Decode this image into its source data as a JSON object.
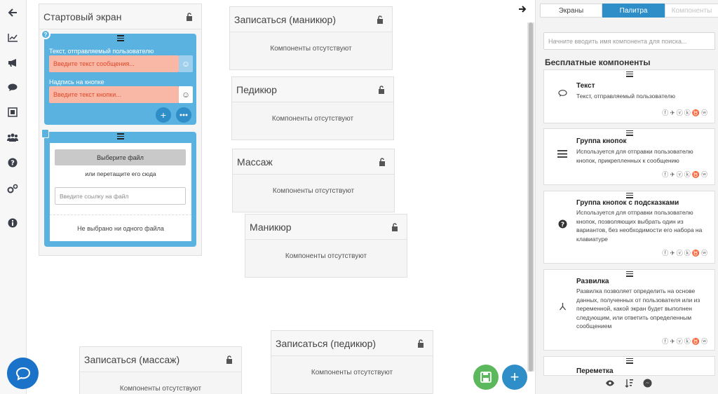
{
  "nav": {
    "icons": [
      "back-arrow-icon",
      "chart-icon",
      "megaphone-icon",
      "chat-icon",
      "frame-icon",
      "users-icon",
      "help-icon",
      "settings-icon",
      "info-icon"
    ]
  },
  "screens": {
    "start": {
      "title": "Стартовый экран",
      "text_label": "Текст, отправляемый пользователю",
      "text_placeholder": "Введите текст сообщения...",
      "button_label": "Надпись на кнопке",
      "button_placeholder": "Введите текст кнопки...",
      "file_button": "Выберите файл",
      "drag_text": "или перетащите его сюда",
      "link_placeholder": "Введите ссылку на файл",
      "no_file": "Не выбрано ни одного файла"
    },
    "manicure_signup": {
      "title": "Записаться (маникюр)",
      "empty": "Компоненты отсутствуют"
    },
    "pedicure": {
      "title": "Педикюр",
      "empty": "Компоненты отсутствуют"
    },
    "massage": {
      "title": "Массаж",
      "empty": "Компоненты отсутствуют"
    },
    "manicure": {
      "title": "Маникюр",
      "empty": "Компоненты отсутствуют"
    },
    "pedicure_signup": {
      "title": "Записаться (педикюр)",
      "empty": "Компоненты отсутствуют"
    },
    "massage_signup": {
      "title": "Записаться (массаж)",
      "empty": "Компоненты отсутствуют"
    }
  },
  "panel": {
    "tabs": [
      "Экраны",
      "Палитра",
      "Компоненты"
    ],
    "active_tab": "Палитра",
    "search_placeholder": "Начните вводить имя компонента для поиска...",
    "section_title": "Бесплатные компоненты",
    "cards": [
      {
        "title": "Текст",
        "desc": "Текст, отправляемый пользователю",
        "icon": "speech-bubble-icon"
      },
      {
        "title": "Группа кнопок",
        "desc": "Используется для отправки пользователю кнопок, прикрепленных к сообщению",
        "icon": "list-bars-icon"
      },
      {
        "title": "Группа кнопок с подсказками",
        "desc": "Используется для отправки пользователю кнопок, позволяющих выбрать один из вариантов, без необходимости его набора на клавиатуре",
        "icon": "question-circle-icon"
      },
      {
        "title": "Развилка",
        "desc": "Развилка позволяет определить на основе данных, полученных от пользователя или из переменной, какой экран будет выполнен следующим, или ответить определенным сообщением",
        "icon": "fork-icon"
      },
      {
        "title": "Переметка",
        "desc": "",
        "icon": "tag-icon"
      }
    ],
    "social_icons": [
      "facebook-icon",
      "telegram-icon",
      "viber-icon",
      "vk-icon",
      "ok-icon",
      "whatsapp-icon"
    ]
  },
  "colors": {
    "accent": "#2f8ec7",
    "component_bg": "#5ab2e0",
    "input_error": "#f9b7a6",
    "save_green": "#5cb85c"
  }
}
